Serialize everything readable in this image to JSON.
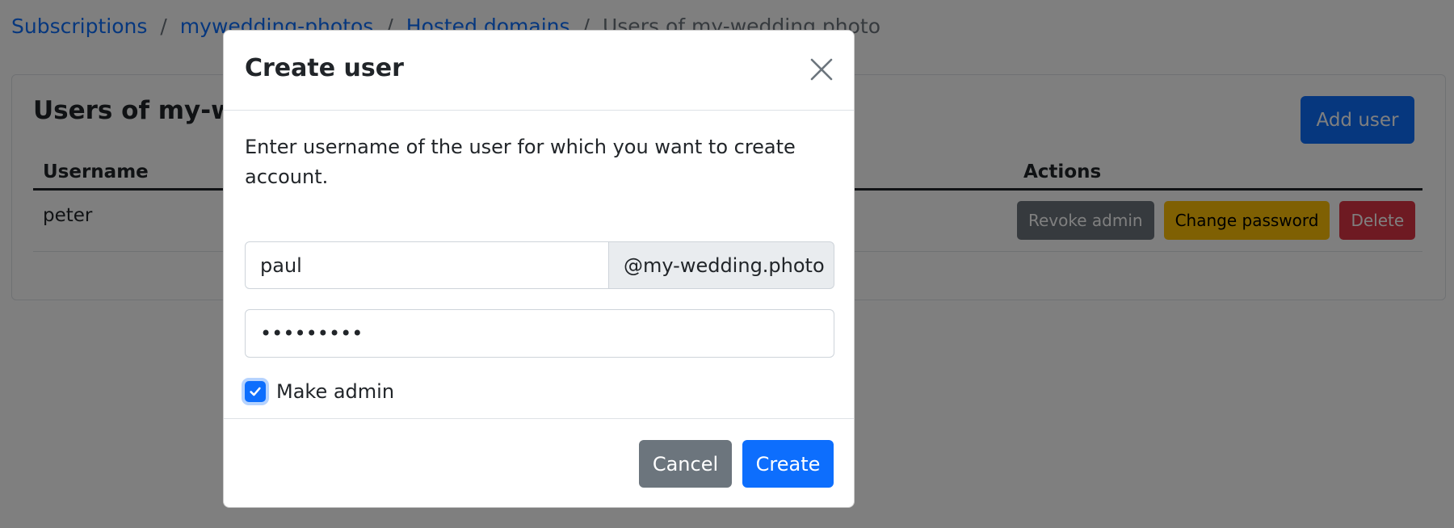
{
  "breadcrumb": {
    "items": [
      "Subscriptions",
      "mywedding-photos",
      "Hosted domains"
    ],
    "separator": "/",
    "current": "Users of my-wedding.photo"
  },
  "card": {
    "title": "Users of my-wedding.photo",
    "add_button": "Add user",
    "table": {
      "headers": [
        "Username",
        "Actions"
      ],
      "rows": [
        {
          "username": "peter",
          "actions": [
            "Revoke admin",
            "Change password",
            "Delete"
          ]
        }
      ]
    }
  },
  "modal": {
    "title": "Create user",
    "close_icon": "close-icon",
    "description": "Enter username of the user for which you want to create account.",
    "username_value": "paul",
    "domain_suffix": "@my-wedding.photo",
    "password_value": "password1",
    "make_admin_label": "Make admin",
    "make_admin_checked": true,
    "cancel_label": "Cancel",
    "create_label": "Create"
  },
  "colors": {
    "primary": "#0d6efd",
    "secondary": "#6c757d",
    "warning": "#ffc107",
    "danger": "#dc3545"
  }
}
